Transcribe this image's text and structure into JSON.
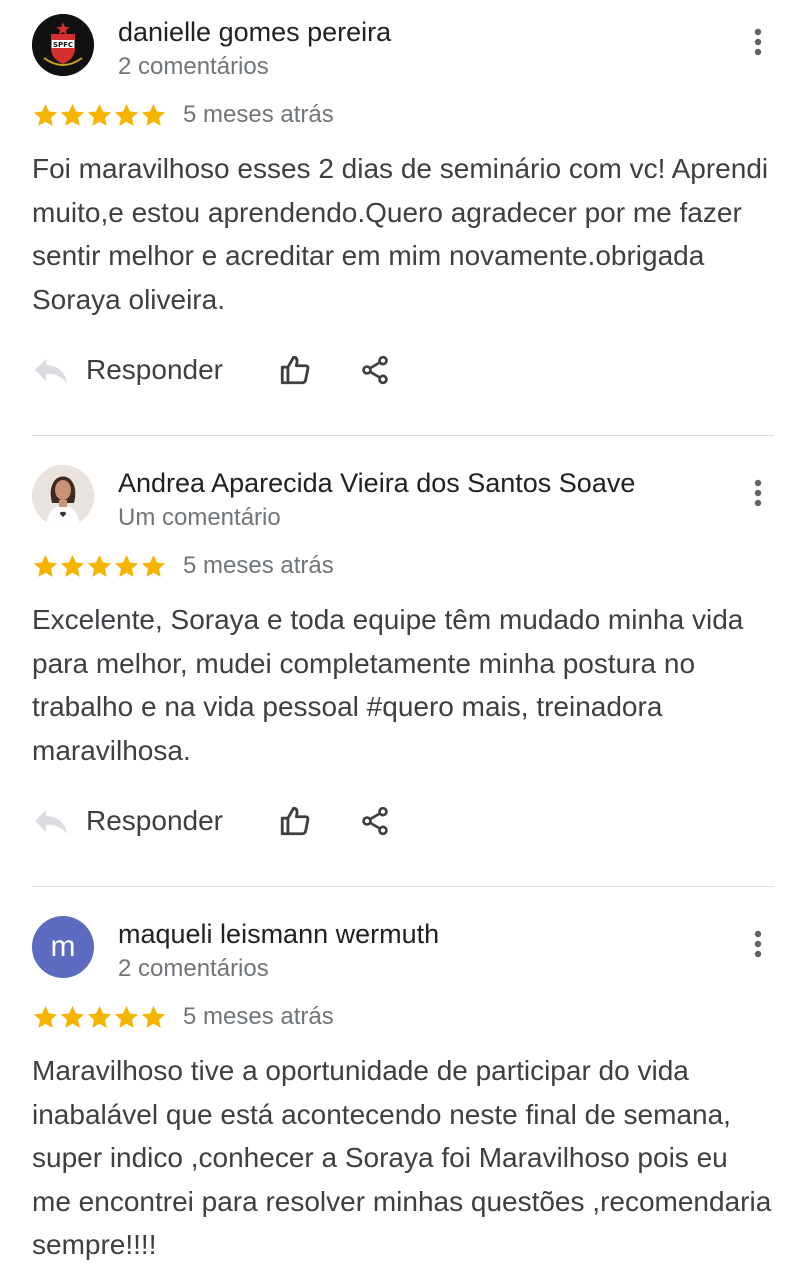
{
  "colors": {
    "star": "#f4b400",
    "avatar_letter_bg": "#5c6bc0",
    "secondary_text": "#70757a",
    "divider": "#dadce0"
  },
  "actions": {
    "reply_label": "Responder",
    "reply_icon": "reply-icon",
    "like_icon": "thumb-up-icon",
    "share_icon": "share-icon",
    "menu_icon": "more-vert-icon"
  },
  "reviews": [
    {
      "author": "danielle gomes pereira",
      "comment_count": "2 comentários",
      "avatar": {
        "type": "logo",
        "logo_text": "SPFC"
      },
      "rating": 5,
      "age": "5 meses atrás",
      "text": "Foi maravilhoso esses 2 dias de seminário com vc! Aprendi muito,e estou aprendendo.Quero agradecer por me fazer sentir melhor e acreditar em mim novamente.obrigada Soraya oliveira."
    },
    {
      "author": "Andrea Aparecida Vieira dos Santos Soave",
      "comment_count": "Um comentário",
      "avatar": {
        "type": "photo"
      },
      "rating": 5,
      "age": "5 meses atrás",
      "text": "Excelente,  Soraya e toda equipe têm mudado minha vida para melhor, mudei completamente minha postura no trabalho e na vida pessoal #quero mais, treinadora maravilhosa."
    },
    {
      "author": "maqueli leismann wermuth",
      "comment_count": "2 comentários",
      "avatar": {
        "type": "letter",
        "letter": "m"
      },
      "rating": 5,
      "age": "5 meses atrás",
      "text": "Maravilhoso tive a oportunidade de participar do vida inabalável que está acontecendo neste final de semana, super indico ,conhecer a Soraya foi Maravilhoso pois eu me encontrei para resolver minhas questões ,recomendaria sempre!!!!"
    }
  ]
}
